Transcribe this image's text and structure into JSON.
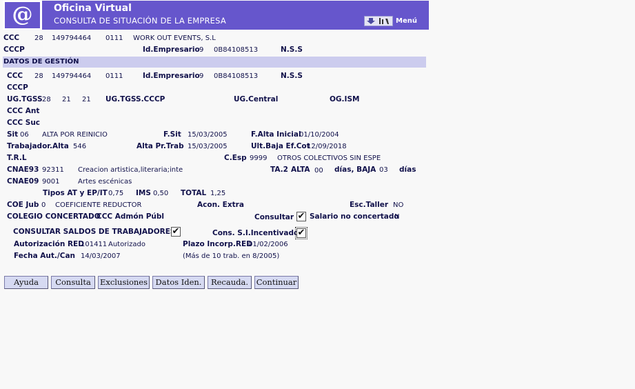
{
  "header": {
    "logo": "@",
    "title": "Oficina Virtual",
    "subtitle": "CONSULTA DE SITUACIÓN DE LA EMPRESA",
    "menu_label": "Menú"
  },
  "top": {
    "ccc_label": "CCC",
    "ccc_1": "28",
    "ccc_2": "149794464",
    "ccc_3": "0111",
    "company_name": "WORK OUT EVENTS, S.L",
    "cccp_label": "CCCP",
    "id_empresario_label": "Id.Empresario",
    "id_empresario_1": "9",
    "id_empresario_2": "0B84108513",
    "nss_label": "N.S.S"
  },
  "section_title": "DATOS DE GESTIÓN",
  "gestion": {
    "ccc_label": "CCC",
    "ccc_1": "28",
    "ccc_2": "149794464",
    "ccc_3": "0111",
    "id_empresario_label": "Id.Empresario",
    "id_empresario_1": "9",
    "id_empresario_2": "0B84108513",
    "nss_label": "N.S.S",
    "cccp_label": "CCCP",
    "ugtgss_label": "UG.TGSS",
    "ugtgss_1": "28",
    "ugtgss_2": "21",
    "ugtgss_3": "21",
    "ugtgss_cccp_label": "UG.TGSS.CCCP",
    "ugcentral_label": "UG.Central",
    "ogism_label": "OG.ISM",
    "ccc_ant_label": "CCC Ant",
    "ccc_suc_label": "CCC Suc",
    "sit_label": "Sit",
    "sit_code": "06",
    "sit_desc": "ALTA POR REINICIO",
    "fsit_label": "F.Sit",
    "fsit_value": "15/03/2005",
    "falta_inicial_label": "F.Alta Inicial",
    "falta_inicial_value": "01/10/2004",
    "trabajador_alta_label": "Trabajador.Alta",
    "trabajador_alta_value": "546",
    "alta_prtrab_label": "Alta Pr.Trab",
    "alta_prtrab_value": "15/03/2005",
    "ult_baja_label": "Ult.Baja Ef.Cot",
    "ult_baja_value": "12/09/2018",
    "trl_label": "T.R.L",
    "cesp_label": "C.Esp",
    "cesp_code": "9999",
    "cesp_desc": "OTROS COLECTIVOS SIN ESPE",
    "cnae93_label": "CNAE93",
    "cnae93_code": "92311",
    "cnae93_desc": "Creacion artistica,literaria;inte",
    "ta2_label": "TA.2",
    "alta_label": "ALTA",
    "alta_value": "00",
    "dias_baja_label": "días, BAJA",
    "baja_value": "03",
    "dias_label": "días",
    "cnae09_label": "CNAE09",
    "cnae09_code": "9001",
    "cnae09_desc": "Artes escénicas",
    "tipos_label": "Tipos AT y EP/IT",
    "tipos_value": "0,75",
    "ims_label": "IMS",
    "ims_value": "0,50",
    "total_label": "TOTAL",
    "total_value": "1,25",
    "coe_jub_label": "COE Jub",
    "coe_jub_code": "0",
    "coe_jub_desc": "COEFICIENTE REDUCTOR",
    "acon_extra_label": "Acon. Extra",
    "esc_taller_label": "Esc.Taller",
    "esc_taller_value": "NO",
    "colegio_label": "COLEGIO CONCERTADO",
    "ccc_admon_label": "CCC Admón Públ",
    "consultar_label": "Consultar",
    "salario_label": "Salario no concertado",
    "salario_value": "N",
    "consultar_saldos_label": "CONSULTAR SALDOS DE TRABAJADORES",
    "cons_si_label": "Cons. S.I.Incentivado",
    "autorizacion_label": "Autorización RED",
    "autorizacion_code": "101411",
    "autorizacion_desc": "Autorizado",
    "plazo_label": "Plazo Incorp.RED",
    "plazo_value": "01/02/2006",
    "fecha_aut_label": "Fecha Aut./Can",
    "fecha_aut_value": "14/03/2007",
    "mas_trab_note": "(Más de 10 trab. en 8/2005)"
  },
  "checkboxes": {
    "consultar_checked": true,
    "saldos_checked": true,
    "cons_si_checked": true
  },
  "buttons": {
    "ayuda": "Ayuda",
    "consulta": "Consulta",
    "exclusiones": "Exclusiones",
    "datos_iden": "Datos Iden.",
    "recauda": "Recauda.",
    "continuar": "Continuar"
  },
  "colors": {
    "header_bg": "#6656cc",
    "section_bg": "#ccccee",
    "text": "#10104a"
  }
}
